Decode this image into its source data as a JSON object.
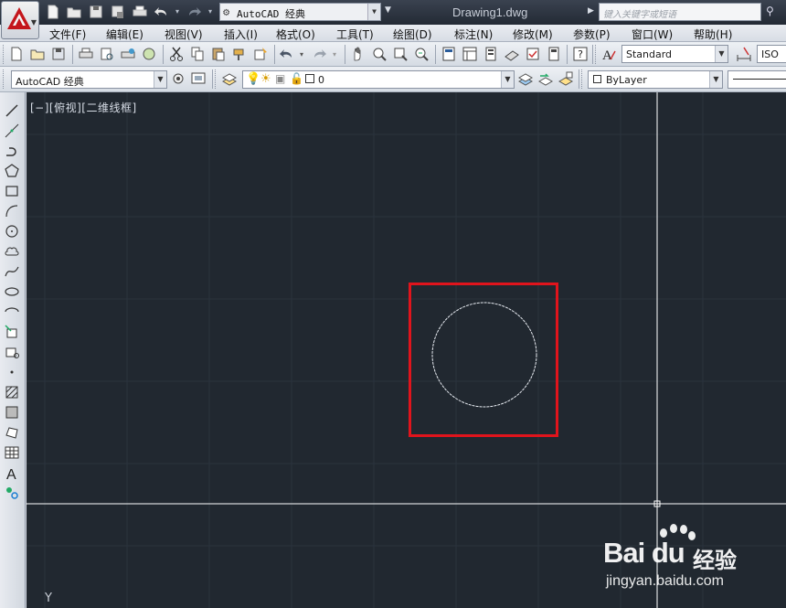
{
  "colors": {
    "accent": "#e0141c",
    "canvas_bg": "#212830",
    "circle": "#e8ecf2",
    "crosshair": "#ffffff"
  },
  "titlebar": {
    "workspace": "AutoCAD 经典",
    "document": "Drawing1.dwg",
    "search_placeholder": "键入关键字或短语"
  },
  "menu": [
    "文件(F)",
    "编辑(E)",
    "视图(V)",
    "插入(I)",
    "格式(O)",
    "工具(T)",
    "绘图(D)",
    "标注(N)",
    "修改(M)",
    "参数(P)",
    "窗口(W)",
    "帮助(H)"
  ],
  "toolbar1": {
    "text_style": "Standard",
    "dim_style": "ISO"
  },
  "toolbar2": {
    "workspace": "AutoCAD 经典",
    "layer": "0",
    "color": "ByLayer"
  },
  "left_toolbar": {
    "icons": [
      "line-icon",
      "construction-line-icon",
      "polyline-icon",
      "polygon-icon",
      "rectangle-icon",
      "arc-icon",
      "circle-icon",
      "revision-cloud-icon",
      "spline-icon",
      "ellipse-icon",
      "ellipse-arc-icon",
      "insert-block-icon",
      "make-block-icon",
      "point-icon",
      "hatch-icon",
      "gradient-icon",
      "region-icon",
      "table-icon",
      "multiline-text-icon",
      "add-selected-icon"
    ]
  },
  "canvas": {
    "view_label": "[−][俯视][二维线框]",
    "y_axis_label": "Y"
  },
  "watermark": {
    "logo": "Bai du",
    "brand": "经验",
    "url": "jingyan.baidu.com"
  }
}
